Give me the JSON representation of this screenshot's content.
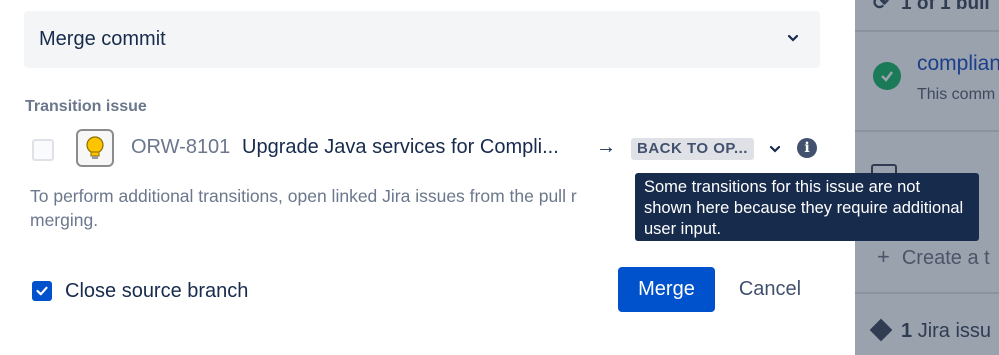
{
  "background": {
    "build_status": "1 of 1 buil",
    "check_link": "complian",
    "check_text": "This comm",
    "create_text": "Create a t",
    "jira_prefix": "1",
    "jira_text": "Jira issu"
  },
  "dialog": {
    "merge_strategy": {
      "value": "Merge commit"
    },
    "transition": {
      "label": "Transition issue",
      "issue_key": "ORW-8101",
      "issue_summary": "Upgrade Java services for Compli...",
      "arrow": "→",
      "status": "BACK TO OP...",
      "help_text": "To perform additional transitions, open linked Jira issues from the pull r",
      "help_text_2": "merging."
    },
    "tooltip": "Some transitions for this issue are not shown here because they require additional user input.",
    "close_source_branch": {
      "label": "Close source branch",
      "checked": true
    },
    "buttons": {
      "merge": "Merge",
      "cancel": "Cancel"
    }
  },
  "colors": {
    "primary": "#0052CC",
    "tooltip_bg": "#172B4D",
    "success": "#1b7a57"
  }
}
